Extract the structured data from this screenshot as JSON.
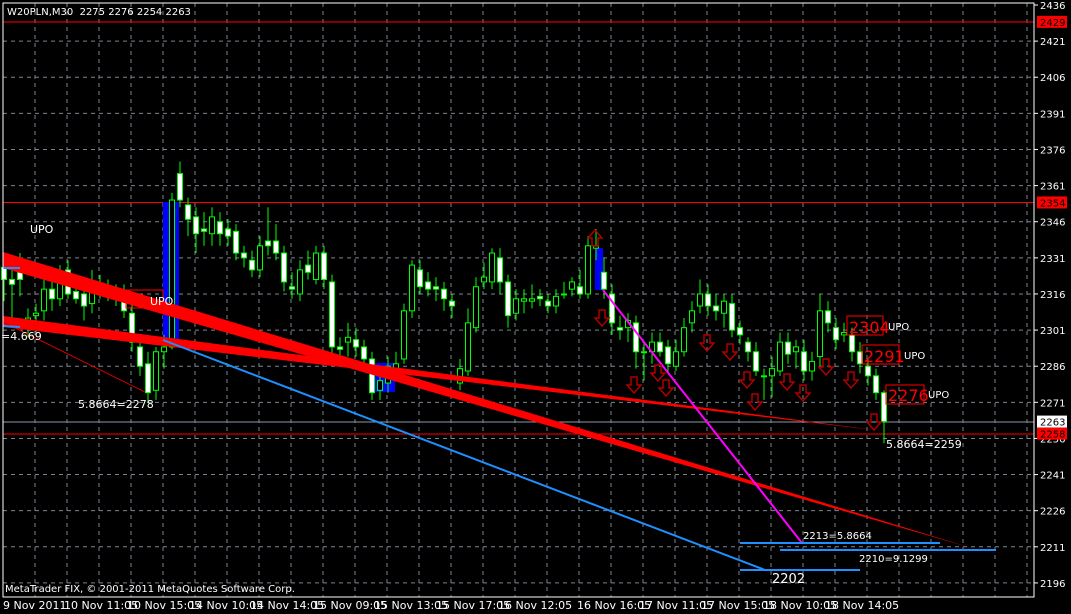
{
  "chart_data": {
    "type": "candlestick",
    "title": "W20PLN,M30  2275 2276 2254 2263",
    "symbol": "W20PLN",
    "timeframe": "M30",
    "last_ohlc": [
      2275,
      2276,
      2254,
      2263
    ],
    "ylim": [
      2190,
      2440
    ],
    "yticks": [
      2436,
      2421,
      2406,
      2391,
      2376,
      2361,
      2346,
      2331,
      2316,
      2301,
      2286,
      2271,
      2256,
      2241,
      2226,
      2211,
      2196
    ],
    "xtick_labels": [
      "9 Nov 2011",
      "10 Nov 11:05",
      "10 Nov 15:05",
      "14 Nov 10:05",
      "14 Nov 14:05",
      "15 Nov 09:05",
      "15 Nov 13:05",
      "15 Nov 17:05",
      "16 Nov 12:05",
      "16 Nov 16:05",
      "17 Nov 11:05",
      "17 Nov 15:05",
      "18 Nov 10:05",
      "18 Nov 14:05"
    ],
    "grid": true,
    "colors": {
      "background": "#000000",
      "candle": "#00ff00",
      "bear_body": "#ffffff",
      "bull_body": "#000000",
      "level": "#ff0000",
      "trendline_blue": "#1e90ff",
      "trendline_magenta": "#ff00ff",
      "box": "#0000ff",
      "arrow": "#8b0000"
    },
    "price_levels": [
      {
        "label": "2429",
        "value": 2429,
        "color": "#ff0000"
      },
      {
        "label": "2354",
        "value": 2354,
        "color": "#ff0000"
      },
      {
        "label": "2263",
        "value": 2263,
        "color": "#ffffff"
      },
      {
        "label": "2258",
        "value": 2258,
        "color": "#ff0000"
      }
    ],
    "candles": [
      [
        2327,
        2330,
        2313,
        2322
      ],
      [
        2322,
        2326,
        2305,
        2320
      ],
      [
        2325,
        2333,
        2315,
        2322
      ],
      [
        2302,
        2310,
        2298,
        2306
      ],
      [
        2307,
        2312,
        2300,
        2308
      ],
      [
        2309,
        2322,
        2305,
        2318
      ],
      [
        2318,
        2321,
        2309,
        2314
      ],
      [
        2314,
        2328,
        2311,
        2325
      ],
      [
        2326,
        2330,
        2314,
        2316
      ],
      [
        2317,
        2320,
        2312,
        2314
      ],
      [
        2316,
        2319,
        2305,
        2311
      ],
      [
        2312,
        2326,
        2308,
        2318
      ],
      [
        2319,
        2324,
        2314,
        2318
      ],
      [
        2318,
        2322,
        2313,
        2316
      ],
      [
        2315,
        2320,
        2311,
        2314
      ],
      [
        2316,
        2320,
        2306,
        2309
      ],
      [
        2308,
        2312,
        2292,
        2296
      ],
      [
        2294,
        2299,
        2282,
        2286
      ],
      [
        2287,
        2292,
        2271,
        2275
      ],
      [
        2276,
        2294,
        2272,
        2292
      ],
      [
        2292,
        2299,
        2285,
        2294
      ],
      [
        2294,
        2358,
        2293,
        2355
      ],
      [
        2366,
        2371,
        2352,
        2355
      ],
      [
        2353,
        2356,
        2340,
        2347
      ],
      [
        2348,
        2352,
        2333,
        2341
      ],
      [
        2343,
        2350,
        2336,
        2342
      ],
      [
        2341,
        2352,
        2336,
        2348
      ],
      [
        2346,
        2350,
        2336,
        2341
      ],
      [
        2343,
        2347,
        2336,
        2340
      ],
      [
        2342,
        2345,
        2330,
        2333
      ],
      [
        2333,
        2336,
        2327,
        2331
      ],
      [
        2330,
        2334,
        2323,
        2326
      ],
      [
        2326,
        2340,
        2323,
        2336
      ],
      [
        2338,
        2352,
        2332,
        2336
      ],
      [
        2338,
        2345,
        2330,
        2333
      ],
      [
        2333,
        2336,
        2317,
        2321
      ],
      [
        2319,
        2325,
        2314,
        2318
      ],
      [
        2316,
        2330,
        2313,
        2326
      ],
      [
        2328,
        2334,
        2322,
        2325
      ],
      [
        2322,
        2336,
        2320,
        2333
      ],
      [
        2333,
        2336,
        2318,
        2322
      ],
      [
        2321,
        2324,
        2288,
        2294
      ],
      [
        2294,
        2298,
        2288,
        2293
      ],
      [
        2296,
        2304,
        2290,
        2298
      ],
      [
        2297,
        2302,
        2290,
        2294
      ],
      [
        2294,
        2297,
        2284,
        2289
      ],
      [
        2289,
        2292,
        2272,
        2275
      ],
      [
        2276,
        2284,
        2272,
        2280
      ],
      [
        2279,
        2290,
        2275,
        2286
      ],
      [
        2284,
        2292,
        2280,
        2287
      ],
      [
        2289,
        2312,
        2287,
        2309
      ],
      [
        2309,
        2330,
        2306,
        2328
      ],
      [
        2326,
        2330,
        2316,
        2319
      ],
      [
        2321,
        2325,
        2315,
        2318
      ],
      [
        2319,
        2323,
        2313,
        2318
      ],
      [
        2318,
        2321,
        2309,
        2314
      ],
      [
        2313,
        2316,
        2306,
        2311
      ],
      [
        2279,
        2289,
        2276,
        2285
      ],
      [
        2284,
        2310,
        2282,
        2304
      ],
      [
        2302,
        2323,
        2300,
        2319
      ],
      [
        2321,
        2329,
        2318,
        2323
      ],
      [
        2321,
        2335,
        2318,
        2333
      ],
      [
        2331,
        2335,
        2316,
        2321
      ],
      [
        2321,
        2324,
        2302,
        2307
      ],
      [
        2308,
        2318,
        2305,
        2314
      ],
      [
        2313,
        2318,
        2308,
        2314
      ],
      [
        2313,
        2320,
        2310,
        2314
      ],
      [
        2315,
        2318,
        2311,
        2314
      ],
      [
        2313,
        2316,
        2308,
        2311
      ],
      [
        2311,
        2318,
        2308,
        2315
      ],
      [
        2316,
        2321,
        2314,
        2316
      ],
      [
        2318,
        2323,
        2315,
        2321
      ],
      [
        2319,
        2326,
        2314,
        2316
      ],
      [
        2316,
        2340,
        2314,
        2336
      ],
      [
        2335,
        2343,
        2330,
        2336
      ],
      [
        2325,
        2331,
        2314,
        2318
      ],
      [
        2316,
        2320,
        2299,
        2304
      ],
      [
        2302,
        2307,
        2297,
        2301
      ],
      [
        2302,
        2308,
        2296,
        2305
      ],
      [
        2304,
        2307,
        2285,
        2292
      ],
      [
        2292,
        2296,
        2280,
        2292
      ],
      [
        2292,
        2300,
        2287,
        2296
      ],
      [
        2296,
        2300,
        2290,
        2292
      ],
      [
        2294,
        2297,
        2283,
        2287
      ],
      [
        2286,
        2297,
        2284,
        2292
      ],
      [
        2292,
        2306,
        2290,
        2302
      ],
      [
        2304,
        2313,
        2300,
        2309
      ],
      [
        2311,
        2322,
        2308,
        2316
      ],
      [
        2316,
        2320,
        2307,
        2311
      ],
      [
        2311,
        2316,
        2305,
        2309
      ],
      [
        2308,
        2316,
        2302,
        2313
      ],
      [
        2312,
        2316,
        2298,
        2301
      ],
      [
        2302,
        2305,
        2295,
        2299
      ],
      [
        2296,
        2298,
        2288,
        2292
      ],
      [
        2292,
        2296,
        2282,
        2284
      ],
      [
        2282,
        2285,
        2272,
        2282
      ],
      [
        2282,
        2290,
        2273,
        2285
      ],
      [
        2284,
        2300,
        2282,
        2296
      ],
      [
        2296,
        2300,
        2287,
        2291
      ],
      [
        2292,
        2297,
        2285,
        2294
      ],
      [
        2292,
        2297,
        2280,
        2284
      ],
      [
        2284,
        2292,
        2280,
        2288
      ],
      [
        2290,
        2316,
        2286,
        2309
      ],
      [
        2309,
        2313,
        2300,
        2304
      ],
      [
        2302,
        2306,
        2293,
        2297
      ],
      [
        2299,
        2304,
        2296,
        2300
      ],
      [
        2299,
        2302,
        2288,
        2292
      ],
      [
        2292,
        2296,
        2283,
        2287
      ],
      [
        2286,
        2289,
        2278,
        2282
      ],
      [
        2282,
        2285,
        2272,
        2275
      ],
      [
        2275,
        2276,
        2254,
        2263
      ]
    ],
    "annotations": {
      "upo_left": "UPO",
      "upo_box": "UPO",
      "ratio_left": "=4.669",
      "ratio_low1": "5.8664=2278",
      "ratio_low2": "5.8664=2259",
      "target1": "2213=5.8664",
      "target2": "2210=9.1299",
      "target3": "2202",
      "box_2304": "2304",
      "box_2291": "2291",
      "box_2276": "2276",
      "upo_2304": "UPO",
      "upo_2291": "UPO",
      "upo_2276": "UPO"
    }
  },
  "footer": {
    "copyright": "MetaTrader FIX, © 2001-2011 MetaQuotes Software Corp."
  }
}
